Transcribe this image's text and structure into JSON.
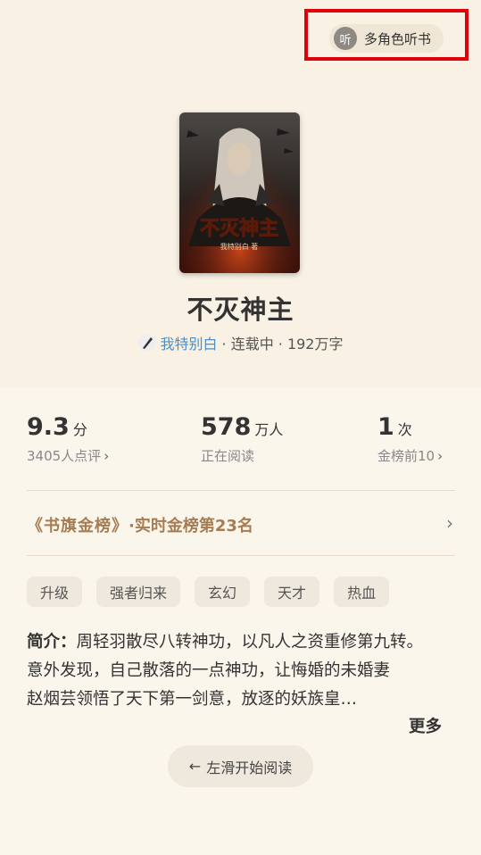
{
  "audio_button": {
    "icon_text": "听",
    "label": "多角色听书"
  },
  "book": {
    "title": "不灭神主",
    "cover_title": "不灭神主",
    "cover_author": "我特别白 著",
    "author": "我特别白",
    "status": "· 连载中 · 192万字"
  },
  "stats": {
    "rating": {
      "value": "9.3",
      "unit": "分",
      "sub": "3405人点评"
    },
    "readers": {
      "value": "578",
      "unit": "万人",
      "sub": "正在阅读"
    },
    "rank_times": {
      "value": "1",
      "unit": "次",
      "sub": "金榜前10"
    }
  },
  "rank": {
    "badge": "《书旗金榜》",
    "text": "·实时金榜第23名"
  },
  "tags": [
    "升级",
    "强者归来",
    "玄幻",
    "天才",
    "热血"
  ],
  "intro": {
    "label": "简介：",
    "line1": "周轻羽散尽八转神功，以凡人之资重修第九转。",
    "line2": "意外发现，自己散落的一点神功，让悔婚的未婚妻赵烟芸领悟了天下第一剑意，放逐的妖族皇…",
    "more": "更多"
  },
  "swipe": {
    "arrow": "←",
    "label": "左滑开始阅读"
  }
}
